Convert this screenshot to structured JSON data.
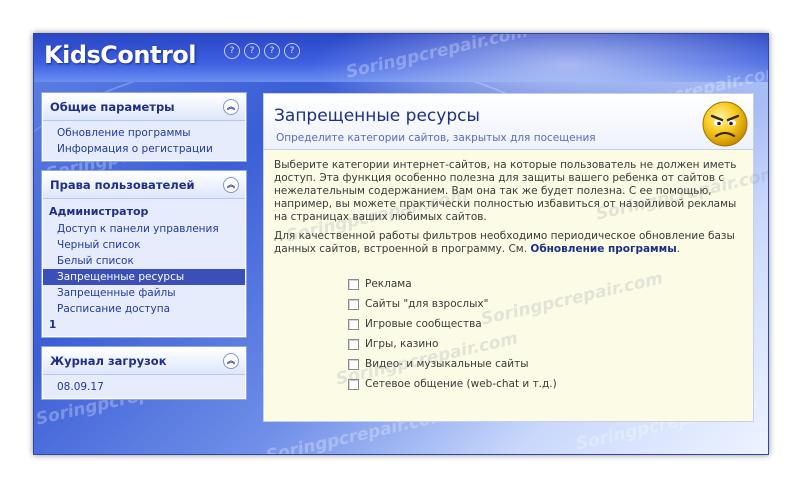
{
  "app": {
    "title": "KidsControl"
  },
  "window_buttons": [
    "?",
    "?",
    "?",
    "?"
  ],
  "sidebar": {
    "general": {
      "title": "Общие параметры",
      "items": [
        "Обновление программы",
        "Информация о регистрации"
      ]
    },
    "user_rights": {
      "title": "Права пользователей",
      "group_label": "Администратор",
      "items": [
        "Доступ к панели управления",
        "Черный список",
        "Белый список",
        "Запрещенные ресурсы",
        "Запрещенные файлы",
        "Расписание доступа"
      ],
      "selected_item": "Запрещенные ресурсы",
      "footnote": "1"
    },
    "download_log": {
      "title": "Журнал загрузок",
      "items": [
        "08.09.17"
      ]
    }
  },
  "content": {
    "title": "Запрещенные ресурсы",
    "subtitle": "Определите категории сайтов, закрытых для посещения",
    "paragraph1": "Выберите категории интернет-сайтов, на которые пользователь не должен иметь доступ. Эта функция особенно полезна для защиты вашего ребенка от сайтов с нежелательным содержанием. Вам она так же будет полезна. С ее помощью, например, вы можете практически полностью избавиться от назойливой рекламы на страницах ваших любимых сайтов.",
    "paragraph2_text": "Для качественной работы фильтров необходимо периодическое обновление базы данных сайтов, встроенной в программу. См. ",
    "paragraph2_link": "Обновление программы",
    "paragraph2_end": ".",
    "categories": [
      {
        "label": "Реклама",
        "checked": false
      },
      {
        "label": "Сайты \"для взрослых\"",
        "checked": false
      },
      {
        "label": "Игровые сообщества",
        "checked": false
      },
      {
        "label": "Игры, казино",
        "checked": false
      },
      {
        "label": "Видео- и музыкальные сайты",
        "checked": false
      },
      {
        "label": "Сетевое общение (web-chat и т.д.)",
        "checked": false
      }
    ]
  },
  "watermark": "Soringpcrepair.com",
  "colors": {
    "accent": "#1e2f8a",
    "selected_bg": "#3a50b8",
    "content_bg": "#fbfbe6"
  }
}
